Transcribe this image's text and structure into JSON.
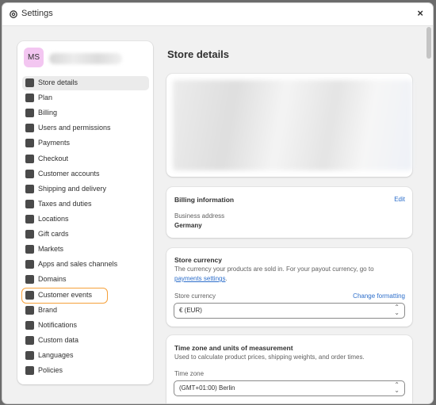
{
  "window": {
    "title": "Settings",
    "close_label": "×"
  },
  "profile": {
    "initials": "MS"
  },
  "sidebar": {
    "items": [
      {
        "label": "Store details",
        "icon": "store-icon"
      },
      {
        "label": "Plan",
        "icon": "plan-icon"
      },
      {
        "label": "Billing",
        "icon": "billing-icon"
      },
      {
        "label": "Users and permissions",
        "icon": "users-icon"
      },
      {
        "label": "Payments",
        "icon": "payments-icon"
      },
      {
        "label": "Checkout",
        "icon": "cart-icon"
      },
      {
        "label": "Customer accounts",
        "icon": "person-icon"
      },
      {
        "label": "Shipping and delivery",
        "icon": "truck-icon"
      },
      {
        "label": "Taxes and duties",
        "icon": "tax-icon"
      },
      {
        "label": "Locations",
        "icon": "location-pin-icon"
      },
      {
        "label": "Gift cards",
        "icon": "gift-card-icon"
      },
      {
        "label": "Markets",
        "icon": "globe-icon"
      },
      {
        "label": "Apps and sales channels",
        "icon": "apps-icon"
      },
      {
        "label": "Domains",
        "icon": "domain-globe-icon"
      },
      {
        "label": "Customer events",
        "icon": "cursor-click-icon"
      },
      {
        "label": "Brand",
        "icon": "brand-icon"
      },
      {
        "label": "Notifications",
        "icon": "bell-icon"
      },
      {
        "label": "Custom data",
        "icon": "database-icon"
      },
      {
        "label": "Languages",
        "icon": "language-icon"
      },
      {
        "label": "Policies",
        "icon": "document-icon"
      }
    ]
  },
  "main": {
    "title": "Store details",
    "billing": {
      "heading": "Billing information",
      "edit": "Edit",
      "address_label": "Business address",
      "address_value": "Germany"
    },
    "currency": {
      "heading": "Store currency",
      "desc_1": "The currency your products are sold in. For your payout currency, go to",
      "desc_link": "payments settings",
      "desc_end": ".",
      "field_label": "Store currency",
      "change_link": "Change formatting",
      "value": "€ (EUR)"
    },
    "timezone": {
      "heading": "Time zone and units of measurement",
      "desc": "Used to calculate product prices, shipping weights, and order times.",
      "field_label": "Time zone",
      "value": "(GMT+01:00) Berlin"
    }
  },
  "colors": {
    "accent_link": "#2c6ecb",
    "avatar_bg": "#f3c6f1",
    "highlight_outline": "#f5a03a"
  }
}
